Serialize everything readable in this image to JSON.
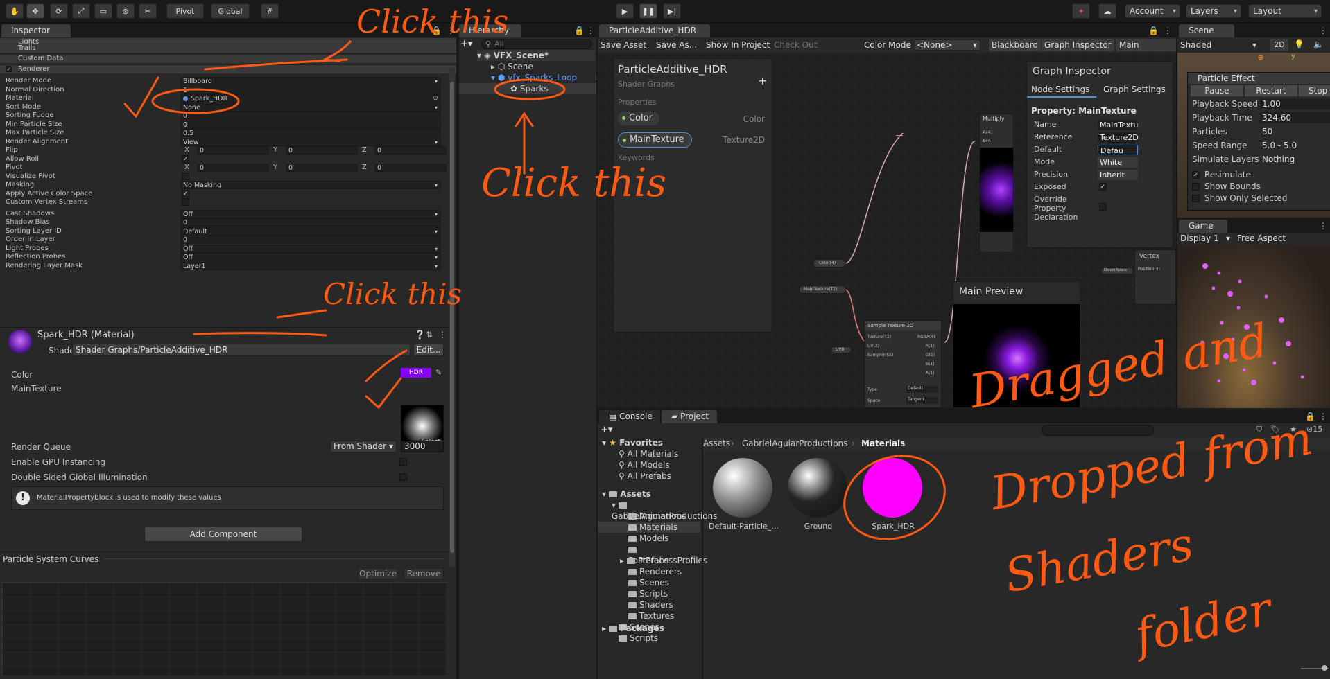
{
  "toolbar": {
    "pivot": "Pivot",
    "global": "Global",
    "account": "Account",
    "layers": "Layers",
    "layout": "Layout"
  },
  "inspector": {
    "tab": "Inspector",
    "modules": {
      "lights": "Lights",
      "trails": "Trails",
      "custom_data": "Custom Data",
      "renderer": "Renderer"
    },
    "rows": [
      {
        "label": "Render Mode",
        "value": "Billboard",
        "type": "dropdown"
      },
      {
        "label": "Normal Direction",
        "value": "1",
        "type": "field"
      },
      {
        "label": "Material",
        "value": "Spark_HDR",
        "type": "object"
      },
      {
        "label": "Sort Mode",
        "value": "None",
        "type": "dropdown"
      },
      {
        "label": "Sorting Fudge",
        "value": "0",
        "type": "field"
      },
      {
        "label": "Min Particle Size",
        "value": "0",
        "type": "field"
      },
      {
        "label": "Max Particle Size",
        "value": "0.5",
        "type": "field"
      },
      {
        "label": "Render Alignment",
        "value": "View",
        "type": "dropdown"
      },
      {
        "label": "Flip",
        "type": "xyz",
        "x": "0",
        "y": "0",
        "z": "0"
      },
      {
        "label": "Allow Roll",
        "type": "check",
        "checked": "✓"
      },
      {
        "label": "Pivot",
        "type": "xyz",
        "x": "0",
        "y": "0",
        "z": "0"
      },
      {
        "label": "Visualize Pivot",
        "type": "check",
        "checked": ""
      },
      {
        "label": "Masking",
        "value": "No Masking",
        "type": "dropdown"
      },
      {
        "label": "Apply Active Color Space",
        "type": "check",
        "checked": "✓"
      },
      {
        "label": "Custom Vertex Streams",
        "type": "check",
        "checked": ""
      },
      {
        "label": "Cast Shadows",
        "value": "Off",
        "type": "dropdown"
      },
      {
        "label": "Shadow Bias",
        "value": "0",
        "type": "field"
      },
      {
        "label": "Sorting Layer ID",
        "value": "Default",
        "type": "dropdown"
      },
      {
        "label": "Order in Layer",
        "value": "0",
        "type": "field"
      },
      {
        "label": "Light Probes",
        "value": "Off",
        "type": "dropdown"
      },
      {
        "label": "Reflection Probes",
        "value": "Off",
        "type": "dropdown"
      },
      {
        "label": "Rendering Layer Mask",
        "value": "Layer1",
        "type": "dropdown"
      }
    ],
    "material": {
      "name": "Spark_HDR (Material)",
      "shader_label": "Shader",
      "shader": "Shader Graphs/ParticleAdditive_HDR",
      "edit": "Edit...",
      "color": "Color",
      "hdr": "HDR",
      "main_texture": "MainTexture",
      "select": "Select",
      "render_queue": "Render Queue",
      "rq_mode": "From Shader",
      "rq_value": "3000",
      "gpu": "Enable GPU Instancing",
      "dsgi": "Double Sided Global Illumination",
      "info": "MaterialPropertyBlock is used to modify these values"
    },
    "add_component": "Add Component",
    "curves": {
      "title": "Particle System Curves",
      "optimize": "Optimize",
      "remove": "Remove"
    }
  },
  "hierarchy": {
    "tab": "Hierarchy",
    "search": "All",
    "scene": "VFX_Scene*",
    "items": [
      "Scene",
      "vfx_Sparks_Loop",
      "Sparks"
    ]
  },
  "shadergraph": {
    "tab": "ParticleAdditive_HDR",
    "toolbar": {
      "save": "Save Asset",
      "save_as": "Save As...",
      "show": "Show In Project",
      "checkout": "Check Out",
      "color_mode": "Color Mode",
      "color_mode_val": "<None>",
      "blackboard": "Blackboard",
      "graph_inspector": "Graph Inspector",
      "main_preview": "Main Preview"
    },
    "blackboard": {
      "title": "ParticleAdditive_HDR",
      "subtitle": "Shader Graphs",
      "properties": "Properties",
      "keywords": "Keywords",
      "props": [
        {
          "name": "Color",
          "type": "Color"
        },
        {
          "name": "MainTexture",
          "type": "Texture2D"
        }
      ]
    },
    "graph_inspector": {
      "title": "Graph Inspector",
      "tab1": "Node Settings",
      "tab2": "Graph Settings",
      "property": "Property: MainTexture",
      "fields": [
        {
          "label": "Name",
          "value": "MainTexture"
        },
        {
          "label": "Reference",
          "value": "Texture2D_"
        },
        {
          "label": "Default",
          "value": "Defau"
        },
        {
          "label": "Mode",
          "value": "White"
        },
        {
          "label": "Precision",
          "value": "Inherit"
        },
        {
          "label": "Exposed",
          "value": "✓"
        },
        {
          "label": "Override Property Declaration",
          "value": ""
        }
      ]
    },
    "nodes": {
      "multiply": "Multiply",
      "a": "A(4)",
      "b": "B(4)",
      "color": "Color(4)",
      "maintex": "MainTexture(T2)",
      "sample": "Sample Texture 2D",
      "texture": "Texture(T2)",
      "uv": "UV(2)",
      "sampler": "Sampler(SS)",
      "rgba": "RGBA(4)",
      "r": "R(1)",
      "g": "G(1)",
      "bch": "B(1)",
      "ach": "A(1)",
      "type": "Type",
      "type_val": "Default",
      "space": "Space",
      "space_val": "Tangent",
      "uv0": "UV0",
      "vertex": "Vertex",
      "object_space": "Object Space",
      "position": "Position(3)"
    },
    "main_preview": "Main Preview"
  },
  "scene": {
    "tab": "Scene",
    "shaded": "Shaded",
    "twod": "2D",
    "particle_effect": "Particle Effect",
    "pause": "Pause",
    "restart": "Restart",
    "stop": "Stop",
    "rows": [
      {
        "label": "Playback Speed",
        "value": "1.00"
      },
      {
        "label": "Playback Time",
        "value": "324.60"
      },
      {
        "label": "Particles",
        "value": "50"
      },
      {
        "label": "Speed Range",
        "value": "5.0 - 5.0"
      },
      {
        "label": "Simulate Layers",
        "value": "Nothing"
      }
    ],
    "checks": [
      {
        "label": "Resimulate",
        "checked": "✓"
      },
      {
        "label": "Show Bounds",
        "checked": ""
      },
      {
        "label": "Show Only Selected",
        "checked": ""
      }
    ]
  },
  "game": {
    "tab": "Game",
    "display": "Display 1",
    "aspect": "Free Aspect"
  },
  "project": {
    "tab_console": "Console",
    "tab_project": "Project",
    "count": "15",
    "breadcrumb": [
      "Assets",
      "GabrielAguiarProductions",
      "Materials"
    ],
    "favorites": "Favorites",
    "fav_items": [
      "All Materials",
      "All Models",
      "All Prefabs"
    ],
    "assets": "Assets",
    "tree": [
      "GabrielAguiarProductions",
      "Animations",
      "Materials",
      "Models",
      "PostProcessProfiles",
      "Prefabs",
      "Renderers",
      "Scenes",
      "Scripts",
      "Shaders",
      "Textures"
    ],
    "root_items": [
      "Scenes",
      "Scripts"
    ],
    "packages": "Packages",
    "files": [
      {
        "name": "Default-Particle_...",
        "color": "#8a8a8a"
      },
      {
        "name": "Ground",
        "color": "#252525"
      },
      {
        "name": "Spark_HDR",
        "color": "#ff00ff"
      }
    ]
  },
  "annotations": {
    "a1": "Click this",
    "a2": "Click this",
    "a3": "Click this",
    "a4": "Dragged and",
    "a5": "Dropped from",
    "a6": "Shaders",
    "a7": "folder"
  },
  "colors": {
    "hdr": "#8a00ff",
    "accent": "#ff5a14",
    "selection": "#2c5d87",
    "magenta": "#ff00ff"
  }
}
